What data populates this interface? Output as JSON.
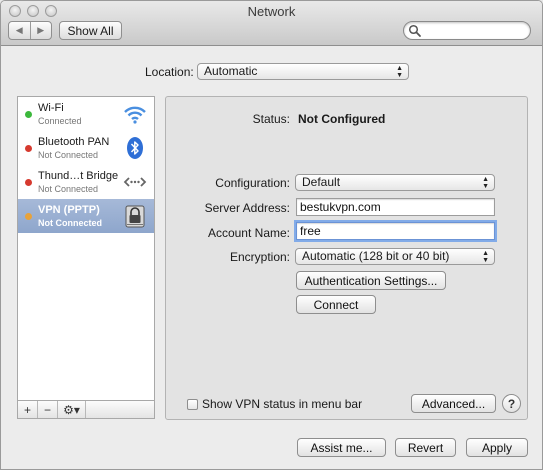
{
  "window": {
    "title": "Network"
  },
  "toolbar": {
    "back_icon": "chevron-left-icon",
    "forward_icon": "chevron-right-icon",
    "show_all_label": "Show All",
    "search_value": ""
  },
  "location": {
    "label": "Location:",
    "value": "Automatic"
  },
  "services": [
    {
      "name": "Wi-Fi",
      "status": "Connected",
      "dot_color": "#3cb83c",
      "icon": "wifi-icon",
      "selected": false
    },
    {
      "name": "Bluetooth PAN",
      "status": "Not Connected",
      "dot_color": "#d63a2f",
      "icon": "bluetooth-icon",
      "selected": false
    },
    {
      "name": "Thund…t Bridge",
      "status": "Not Connected",
      "dot_color": "#d63a2f",
      "icon": "thunderbolt-bridge-icon",
      "selected": false
    },
    {
      "name": "VPN (PPTP)",
      "status": "Not Connected",
      "dot_color": "#e8a23a",
      "icon": "vpn-lock-icon",
      "selected": true
    }
  ],
  "sidebar_tools": {
    "add": "+",
    "remove": "−",
    "gear": "⚙▾"
  },
  "detail": {
    "status_label": "Status:",
    "status_value": "Not Configured",
    "configuration_label": "Configuration:",
    "configuration_value": "Default",
    "server_address_label": "Server Address:",
    "server_address_value": "bestukvpn.com",
    "account_name_label": "Account Name:",
    "account_name_value": "free",
    "encryption_label": "Encryption:",
    "encryption_value": "Automatic (128 bit or 40 bit)",
    "auth_settings_label": "Authentication Settings...",
    "connect_label": "Connect",
    "show_vpn_status_label": "Show VPN status in menu bar",
    "show_vpn_status_checked": false,
    "advanced_label": "Advanced...",
    "help_label": "?"
  },
  "footer": {
    "assist_label": "Assist me...",
    "revert_label": "Revert",
    "apply_label": "Apply"
  },
  "colors": {
    "selection": "#8ea6cc",
    "focus_ring": "#82abe8"
  }
}
